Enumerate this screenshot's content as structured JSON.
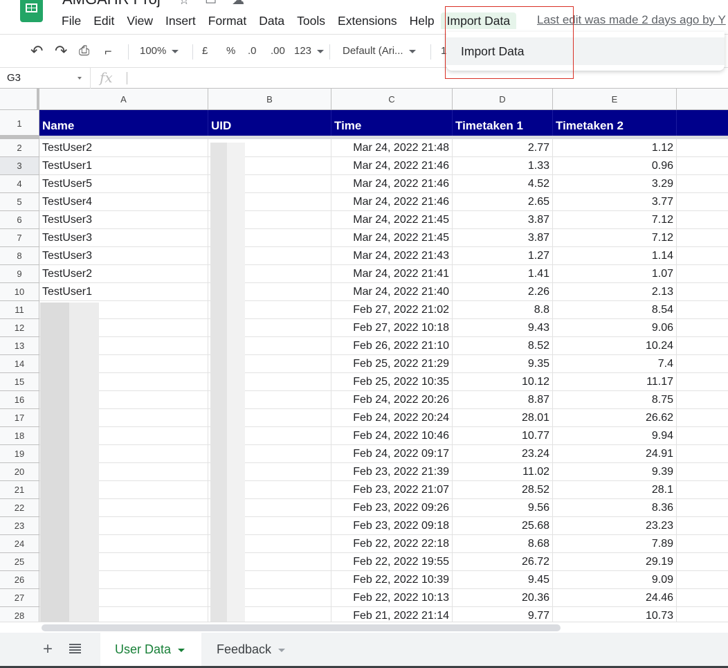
{
  "app": {
    "doc_title": "AMGAHR Proj",
    "title_icons": [
      "star-icon",
      "move-icon",
      "cloud-status-icon"
    ]
  },
  "menu": {
    "items": [
      "File",
      "Edit",
      "View",
      "Insert",
      "Format",
      "Data",
      "Tools",
      "Extensions",
      "Help",
      "Import Data"
    ],
    "active": "Import Data",
    "last_edit": "Last edit was made 2 days ago by Y"
  },
  "dropdown": {
    "items": [
      "Import Data"
    ]
  },
  "toolbar": {
    "undo": "undo-icon",
    "redo": "redo-icon",
    "print": "print-icon",
    "paint_format": "paint-format-icon",
    "zoom": "100%",
    "currency": "£",
    "percent": "%",
    "decrease_decimal": ".0",
    "increase_decimal": ".00",
    "more_formats": "123",
    "font": "Default (Ari...",
    "font_size": "1"
  },
  "formula_bar": {
    "name_box": "G3",
    "fx_label": "fx",
    "value": ""
  },
  "grid": {
    "columns": [
      "A",
      "B",
      "C",
      "D",
      "E"
    ],
    "header_row": [
      "Name",
      "UID",
      "Time",
      "Timetaken 1",
      "Timetaken 2"
    ],
    "header_color": "#00008b",
    "rows": [
      {
        "num": "2",
        "name": "TestUser2",
        "time": "Mar 24, 2022 21:48",
        "t1": "2.77",
        "t2": "1.12"
      },
      {
        "num": "3",
        "name": "TestUser1",
        "time": "Mar 24, 2022 21:46",
        "t1": "1.33",
        "t2": "0.96"
      },
      {
        "num": "4",
        "name": "TestUser5",
        "time": "Mar 24, 2022 21:46",
        "t1": "4.52",
        "t2": "3.29"
      },
      {
        "num": "5",
        "name": "TestUser4",
        "time": "Mar 24, 2022 21:46",
        "t1": "2.65",
        "t2": "3.77"
      },
      {
        "num": "6",
        "name": "TestUser3",
        "time": "Mar 24, 2022 21:45",
        "t1": "3.87",
        "t2": "7.12"
      },
      {
        "num": "7",
        "name": "TestUser3",
        "time": "Mar 24, 2022 21:45",
        "t1": "3.87",
        "t2": "7.12"
      },
      {
        "num": "8",
        "name": "TestUser3",
        "time": "Mar 24, 2022 21:43",
        "t1": "1.27",
        "t2": "1.14"
      },
      {
        "num": "9",
        "name": "TestUser2",
        "time": "Mar 24, 2022 21:41",
        "t1": "1.41",
        "t2": "1.07"
      },
      {
        "num": "10",
        "name": "TestUser1",
        "time": "Mar 24, 2022 21:40",
        "t1": "2.26",
        "t2": "2.13"
      },
      {
        "num": "11",
        "name": "",
        "time": "Feb 27, 2022 21:02",
        "t1": "8.8",
        "t2": "8.54"
      },
      {
        "num": "12",
        "name": "",
        "time": "Feb 27, 2022 10:18",
        "t1": "9.43",
        "t2": "9.06"
      },
      {
        "num": "13",
        "name": "",
        "time": "Feb 26, 2022 21:10",
        "t1": "8.52",
        "t2": "10.24"
      },
      {
        "num": "14",
        "name": "",
        "time": "Feb 25, 2022 21:29",
        "t1": "9.35",
        "t2": "7.4"
      },
      {
        "num": "15",
        "name": "",
        "time": "Feb 25, 2022 10:35",
        "t1": "10.12",
        "t2": "11.17"
      },
      {
        "num": "16",
        "name": "",
        "time": "Feb 24, 2022 20:26",
        "t1": "8.87",
        "t2": "8.75"
      },
      {
        "num": "17",
        "name": "",
        "time": "Feb 24, 2022 20:24",
        "t1": "28.01",
        "t2": "26.62"
      },
      {
        "num": "18",
        "name": "",
        "time": "Feb 24, 2022 10:46",
        "t1": "10.77",
        "t2": "9.94"
      },
      {
        "num": "19",
        "name": "",
        "time": "Feb 24, 2022 09:17",
        "t1": "23.24",
        "t2": "24.91"
      },
      {
        "num": "20",
        "name": "",
        "time": "Feb 23, 2022 21:39",
        "t1": "11.02",
        "t2": "9.39"
      },
      {
        "num": "21",
        "name": "",
        "time": "Feb 23, 2022 21:07",
        "t1": "28.52",
        "t2": "28.1"
      },
      {
        "num": "22",
        "name": "",
        "time": "Feb 23, 2022 09:26",
        "t1": "9.56",
        "t2": "8.36"
      },
      {
        "num": "23",
        "name": "",
        "time": "Feb 23, 2022 09:18",
        "t1": "25.68",
        "t2": "23.23"
      },
      {
        "num": "24",
        "name": "",
        "time": "Feb 22, 2022 22:18",
        "t1": "8.68",
        "t2": "7.89"
      },
      {
        "num": "25",
        "name": "",
        "time": "Feb 22, 2022 19:55",
        "t1": "26.72",
        "t2": "29.19"
      },
      {
        "num": "26",
        "name": "",
        "time": "Feb 22, 2022 10:39",
        "t1": "9.45",
        "t2": "9.09"
      },
      {
        "num": "27",
        "name": "",
        "time": "Feb 22, 2022 10:13",
        "t1": "20.36",
        "t2": "24.46"
      },
      {
        "num": "28",
        "name": "",
        "time": "Feb 21, 2022 21:14",
        "t1": "9.77",
        "t2": "10.73"
      }
    ]
  },
  "sheets": {
    "add_icon": "+",
    "tabs": [
      {
        "label": "User Data",
        "active": true
      },
      {
        "label": "Feedback",
        "active": false
      }
    ]
  }
}
